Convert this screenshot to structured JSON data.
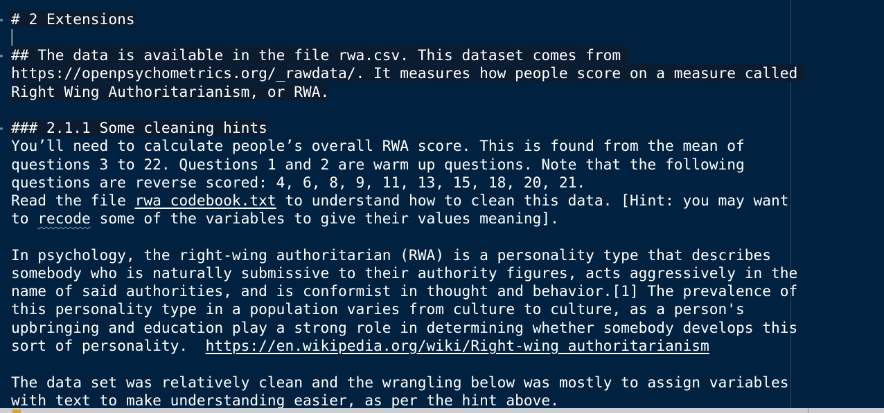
{
  "editor": {
    "lines": [
      "# 2 Extensions",
      "",
      "## The data is available in the file rwa.csv. This dataset comes from ",
      "https://openpsychometrics.org/_rawdata/. It measures how people score on a measure called ",
      "Right Wing Authoritarianism, or RWA.",
      "",
      "### 2.1.1 Some cleaning hints",
      "You’ll need to calculate people’s overall RWA score. This is found from the mean of ",
      "questions 3 to 22. Questions 1 and 2 are warm up questions. Note that the following ",
      "questions are reverse scored: 4, 6, 8, 9, 11, 13, 15, 18, 20, 21.",
      "Read the file ",
      "rwa_codebook.txt",
      " to understand how to clean this data. [Hint: you may want ",
      "to ",
      "recode",
      " some of the variables to give their values meaning].",
      "",
      "In psychology, the right-wing authoritarian (RWA) is a personality type that describes ",
      "somebody who is naturally submissive to their authority figures, acts aggressively in the ",
      "name of said authorities, and is conformist in thought and behavior.[1] The prevalence of ",
      "this personality type in a population varies from culture to culture, as a person's ",
      "upbringing and education play a strong role in determining whether somebody develops this ",
      "sort of personality.  ",
      "https://en.wikipedia.org/wiki/Right-wing_authoritarianism",
      "",
      "The data set was relatively clean and the wrangling below was mostly to assign variables ",
      "with text to make understanding easier, as per the hint above."
    ]
  },
  "colors": {
    "background": "#002240",
    "text": "#ffffff",
    "heading_highlight": "#0b1c31"
  }
}
